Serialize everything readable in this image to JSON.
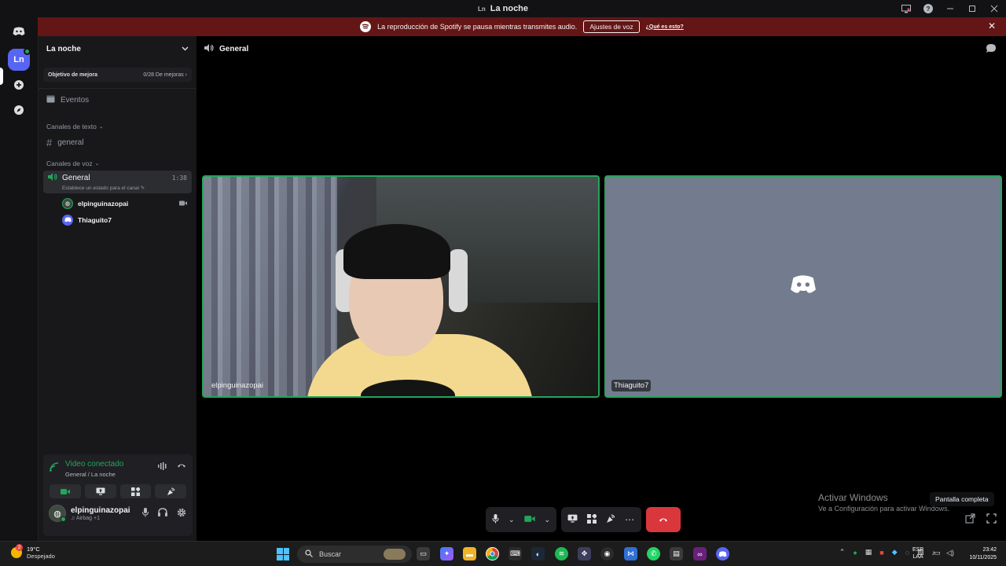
{
  "titlebar": {
    "badge": "Ln",
    "title": "La noche"
  },
  "rail": {
    "active_server": "Ln"
  },
  "banner": {
    "message": "La reproducción de Spotify se pausa mientras transmites audio.",
    "button": "Ajustes de voz",
    "link": "¿Qué es esto?"
  },
  "sidebar": {
    "server_name": "La noche",
    "boost": {
      "label": "Objetivo de mejora",
      "count": "0/28 De mejoras"
    },
    "events": "Eventos",
    "text_category": "Canales de texto",
    "text_channels": [
      "general"
    ],
    "voice_category": "Canales de voz",
    "voice_channel": {
      "name": "General",
      "timer": "1:38",
      "status": "Establece un estado para el canal"
    },
    "voice_users": [
      "elpinguinazopai",
      "Thiaguito7"
    ]
  },
  "voice_panel": {
    "title": "Video conectado",
    "subtitle": "General / La noche"
  },
  "user": {
    "name": "elpinguinazopai",
    "sub": "Airbag +1"
  },
  "main": {
    "channel": "General",
    "tiles": [
      "elpinguinazopai",
      "Thiaguito7"
    ],
    "tooltip": "Pantalla completa"
  },
  "watermark": {
    "line1": "Activar Windows",
    "line2": "Ve a Configuración para activar Windows."
  },
  "taskbar": {
    "temp": "19°C",
    "condition": "Despejado",
    "search": "Buscar",
    "lang1": "ESP",
    "lang2": "LAA",
    "time": "23:42",
    "date": "10/11/2025",
    "weather_badge": "2"
  },
  "colors": {
    "accent": "#5865f2",
    "green": "#23a55a",
    "hangup": "#da373c",
    "banner": "#641515"
  }
}
